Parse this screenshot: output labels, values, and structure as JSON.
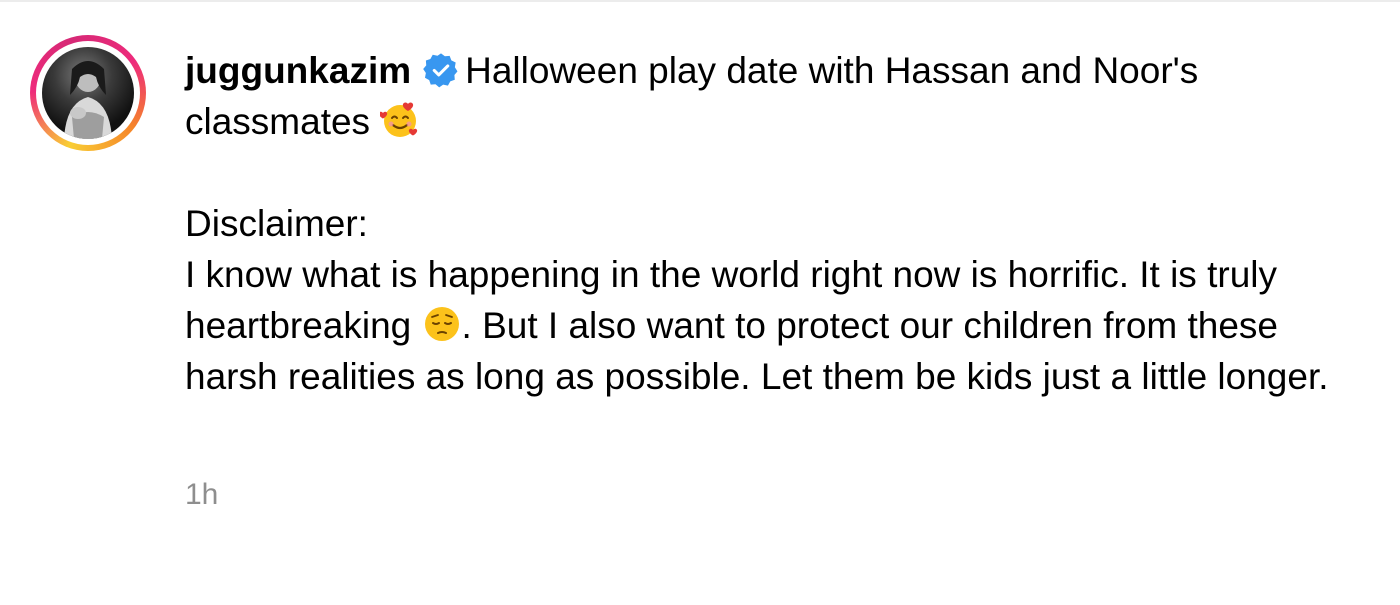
{
  "post": {
    "username": "juggunkazim",
    "caption_line1": "Halloween play date with Hassan and Noor's classmates",
    "disclaimer_label": "Disclaimer:",
    "disclaimer_part1": "I know what is happening in the world right now is horrific. It is truly heartbreaking",
    "disclaimer_part2": ". But I also want to protect our children from these harsh realities as long as possible. Let them be kids just a little longer.",
    "timestamp": "1h",
    "icons": {
      "verified": "verified-badge-icon",
      "emoji_hearts": "smiling-face-with-hearts-emoji",
      "emoji_pensive": "pensive-face-emoji"
    },
    "colors": {
      "verified": "#3897f0",
      "timestamp": "#8e8e8e",
      "ring_start": "#f9ce34",
      "ring_mid": "#ee2a7b",
      "ring_end": "#f58529"
    }
  }
}
